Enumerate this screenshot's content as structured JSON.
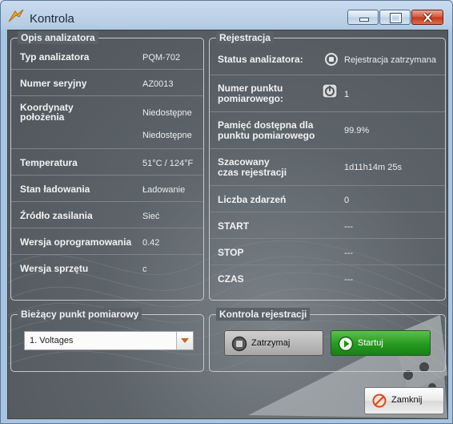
{
  "window": {
    "title": "Kontrola",
    "controls": {
      "minimize": "minimize",
      "maximize": "maximize",
      "close": "close"
    }
  },
  "analyzer": {
    "legend": "Opis analizatora",
    "rows": [
      {
        "label": "Typ analizatora",
        "value": "PQM-702"
      },
      {
        "label": "Numer seryjny",
        "value": "AZ0013"
      },
      {
        "label": "Koordynaty\npołożenia",
        "value": "Niedostępne",
        "value2": "Niedostępne"
      },
      {
        "label": "Temperatura",
        "value": "51°C / 124°F"
      },
      {
        "label": "Stan ładowania",
        "value": "Ładowanie"
      },
      {
        "label": "Źródło zasilania",
        "value": "Sieć"
      },
      {
        "label": "Wersja oprogramowania",
        "value": "0.42"
      },
      {
        "label": "Wersja sprzętu",
        "value": "c"
      }
    ]
  },
  "registration": {
    "legend": "Rejestracja",
    "rows": [
      {
        "label": "Status analizatora:",
        "value": "Rejestracja zatrzymana",
        "icon": "stop-status-icon"
      },
      {
        "label": "Numer punktu\npomiarowego:",
        "value": "1",
        "icon": "measurement-point-icon"
      },
      {
        "label": "Pamięć dostępna dla\npunktu pomiarowego",
        "value": "99.9%"
      },
      {
        "label": "Szacowany\nczas rejestracji",
        "value": "1d11h14m 25s"
      },
      {
        "label": "Liczba zdarzeń",
        "value": "0"
      },
      {
        "label": "START",
        "value": "---"
      },
      {
        "label": "STOP",
        "value": "---"
      },
      {
        "label": "CZAS",
        "value": "---"
      }
    ]
  },
  "current_point": {
    "legend": "Bieżący punkt pomiarowy",
    "selected": "1. Voltages"
  },
  "rec_control": {
    "legend": "Kontrola rejestracji",
    "stop_label": "Zatrzymaj",
    "start_label": "Startuj"
  },
  "footer": {
    "close_label": "Zamknij"
  },
  "colors": {
    "start_green": "#259a1f",
    "close_red": "#c2371b",
    "panel_dark": "#5b6267"
  }
}
